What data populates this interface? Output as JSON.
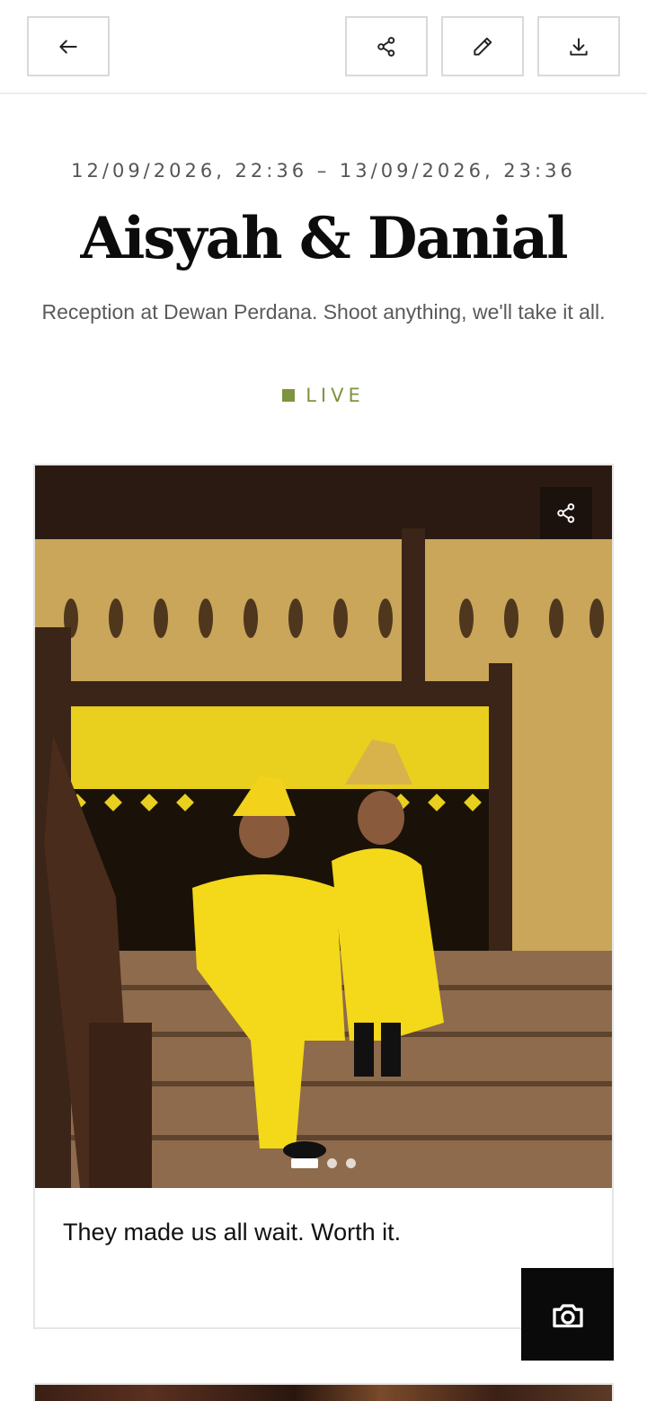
{
  "toolbar": {
    "back_icon": "arrow-left-icon",
    "share_icon": "share-icon",
    "edit_icon": "pencil-icon",
    "download_icon": "download-icon"
  },
  "event": {
    "date_range": "12/09/2026, 22:36 – 13/09/2026, 23:36",
    "title": "Aisyah & Danial",
    "description": "Reception at Dewan Perdana. Shoot anything, we'll take it all.",
    "status": "LIVE",
    "status_color": "#7d9440"
  },
  "post": {
    "caption": "They made us all wait. Worth it.",
    "carousel_total": 3,
    "carousel_active": 1,
    "share_icon": "share-icon"
  },
  "fab": {
    "icon": "camera-icon",
    "color": "#0a0a0a"
  }
}
